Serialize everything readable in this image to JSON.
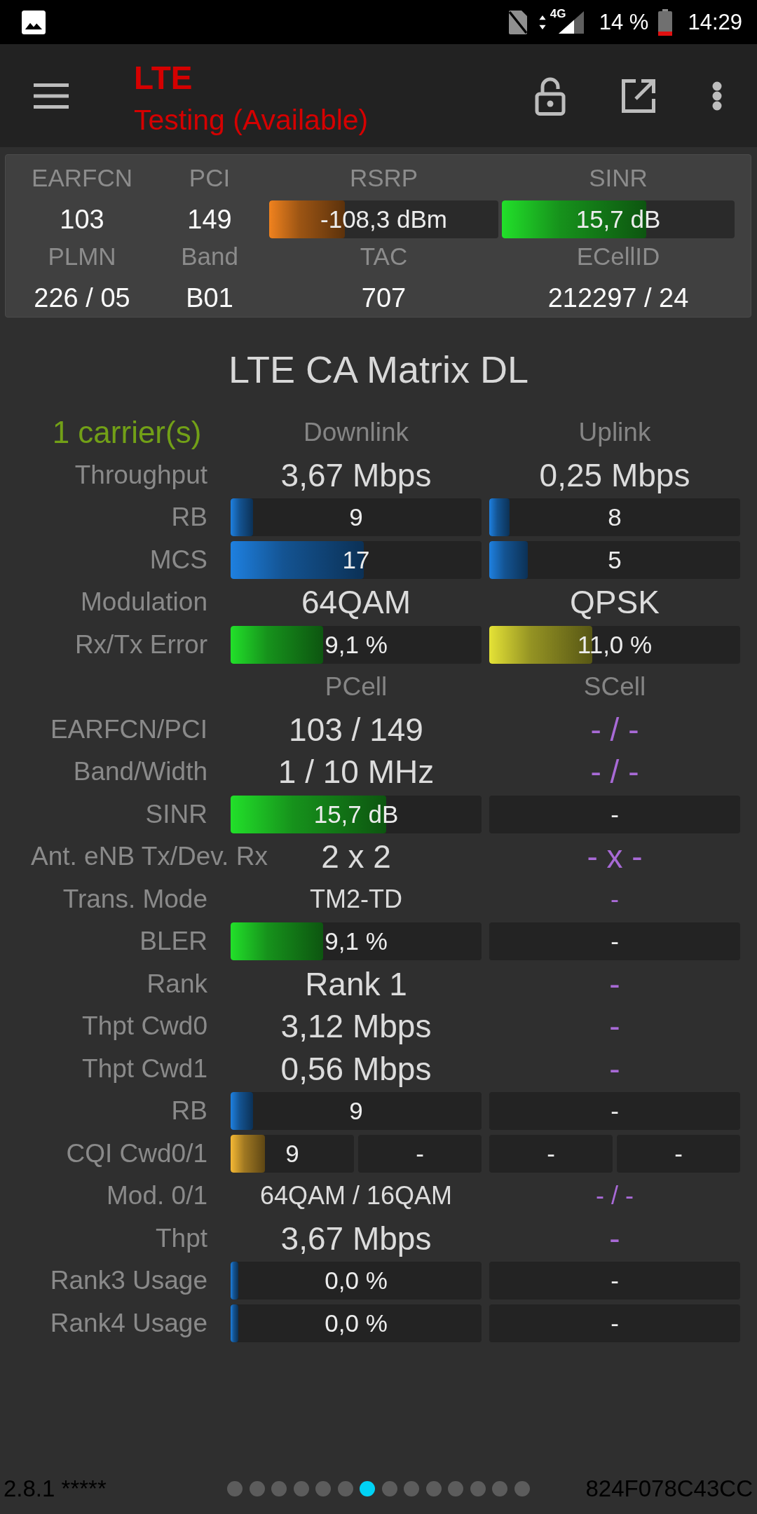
{
  "status_bar": {
    "network": "4G",
    "battery": "14 %",
    "time": "14:29"
  },
  "toolbar": {
    "title": "LTE",
    "subtitle": "Testing (Available)"
  },
  "info_panel": {
    "cells": [
      {
        "kind": "text",
        "label": "EARFCN",
        "value": "103"
      },
      {
        "kind": "text",
        "label": "PCI",
        "value": "149"
      },
      {
        "kind": "meter",
        "label": "RSRP",
        "value": "-108,3 dBm",
        "level": 0.33,
        "color": "#f0821e"
      },
      {
        "kind": "meter",
        "label": "SINR",
        "value": "15,7 dB",
        "level": 0.62,
        "color": "#22e02a"
      },
      {
        "kind": "text",
        "label": "PLMN",
        "value": "226 / 05"
      },
      {
        "kind": "text",
        "label": "Band",
        "value": "B01"
      },
      {
        "kind": "text",
        "label": "TAC",
        "value": "707"
      },
      {
        "kind": "text",
        "label": "ECellID",
        "value": "212297 / 24"
      }
    ]
  },
  "matrix": {
    "title": "LTE CA Matrix DL",
    "rows": [
      {
        "kind": "header",
        "label": "1 carrier(s)",
        "cells": [
          {
            "text": "Downlink"
          },
          {
            "text": "Uplink"
          }
        ]
      },
      {
        "kind": "value",
        "label": "Throughput",
        "cells": [
          {
            "text": "3,67 Mbps",
            "available": true
          },
          {
            "text": "0,25 Mbps",
            "available": true
          }
        ]
      },
      {
        "kind": "meter",
        "label": "RB",
        "cells": [
          {
            "text": "9",
            "level": 0.09,
            "color": "#1e80e0"
          },
          {
            "text": "8",
            "level": 0.08,
            "color": "#1e80e0"
          }
        ]
      },
      {
        "kind": "meter",
        "label": "MCS",
        "cells": [
          {
            "text": "17",
            "level": 0.53,
            "color": "#1e80e0"
          },
          {
            "text": "5",
            "level": 0.155,
            "color": "#1e80e0"
          }
        ]
      },
      {
        "kind": "value",
        "label": "Modulation",
        "cells": [
          {
            "text": "64QAM",
            "available": true
          },
          {
            "text": "QPSK",
            "available": true
          }
        ]
      },
      {
        "kind": "meter",
        "label": "Rx/Tx Error",
        "cells": [
          {
            "text": "9,1 %",
            "level": 0.37,
            "color": "#22e02a"
          },
          {
            "text": "11,0 %",
            "level": 0.41,
            "color": "#e4e236"
          }
        ]
      },
      {
        "kind": "header",
        "cells": [
          {
            "text": "PCell"
          },
          {
            "text": "SCell"
          }
        ]
      },
      {
        "kind": "value",
        "label": "EARFCN/PCI",
        "cells": [
          {
            "text": "103 / 149",
            "available": true
          },
          {
            "text": "- / -",
            "available": false
          }
        ]
      },
      {
        "kind": "value",
        "label": "Band/Width",
        "cells": [
          {
            "text": "1 / 10 MHz",
            "available": true
          },
          {
            "text": "- / -",
            "available": false
          }
        ]
      },
      {
        "kind": "meter",
        "label": "SINR",
        "cells": [
          {
            "text": "15,7 dB",
            "level": 0.62,
            "color": "#22e02a"
          },
          {
            "text": "-"
          }
        ]
      },
      {
        "kind": "value",
        "label": "Ant. eNB Tx/Dev. Rx",
        "cells": [
          {
            "text": "2 x 2",
            "available": true
          },
          {
            "text": "- x -",
            "available": false
          }
        ]
      },
      {
        "kind": "value_small",
        "label": "Trans. Mode",
        "cells": [
          {
            "text": "TM2-TD",
            "available": true
          },
          {
            "text": "-",
            "available": false
          }
        ]
      },
      {
        "kind": "meter",
        "label": "BLER",
        "cells": [
          {
            "text": "9,1 %",
            "level": 0.37,
            "color": "#22e02a"
          },
          {
            "text": "-"
          }
        ]
      },
      {
        "kind": "value",
        "label": "Rank",
        "cells": [
          {
            "text": "Rank 1",
            "available": true
          },
          {
            "text": "-",
            "available": false
          }
        ]
      },
      {
        "kind": "value",
        "label": "Thpt Cwd0",
        "cells": [
          {
            "text": "3,12 Mbps",
            "available": true
          },
          {
            "text": "-",
            "available": false
          }
        ]
      },
      {
        "kind": "value",
        "label": "Thpt Cwd1",
        "cells": [
          {
            "text": "0,56 Mbps",
            "available": true
          },
          {
            "text": "-",
            "available": false
          }
        ]
      },
      {
        "kind": "meter",
        "label": "RB",
        "cells": [
          {
            "text": "9",
            "level": 0.09,
            "color": "#1e80e0"
          },
          {
            "text": "-"
          }
        ]
      },
      {
        "kind": "split_meter",
        "label": "CQI Cwd0/1",
        "cells": [
          {
            "parts": [
              {
                "text": "9",
                "level": 0.28,
                "color": "#f5b834"
              },
              {
                "text": "-"
              }
            ]
          },
          {
            "parts": [
              {
                "text": "-"
              },
              {
                "text": "-"
              }
            ]
          }
        ]
      },
      {
        "kind": "value_small",
        "label": "Mod. 0/1",
        "cells": [
          {
            "text": "64QAM / 16QAM",
            "available": true
          },
          {
            "text": "- / -",
            "available": false
          }
        ]
      },
      {
        "kind": "value",
        "label": "Thpt",
        "cells": [
          {
            "text": "3,67 Mbps",
            "available": true
          },
          {
            "text": "-",
            "available": false
          }
        ]
      },
      {
        "kind": "meter",
        "label": "Rank3 Usage",
        "cells": [
          {
            "text": "0,0 %",
            "level": 0.03,
            "color": "#1e80e0"
          },
          {
            "text": "-"
          }
        ]
      },
      {
        "kind": "meter",
        "label": "Rank4 Usage",
        "cells": [
          {
            "text": "0,0 %",
            "level": 0.03,
            "color": "#1e80e0"
          },
          {
            "text": "-"
          }
        ]
      }
    ]
  },
  "footer": {
    "version": "2.8.1 *****",
    "pages": [
      {
        "selected": false
      },
      {
        "selected": false
      },
      {
        "selected": false
      },
      {
        "selected": false
      },
      {
        "selected": false
      },
      {
        "selected": false
      },
      {
        "selected": true
      },
      {
        "selected": false
      },
      {
        "selected": false
      },
      {
        "selected": false
      },
      {
        "selected": false
      },
      {
        "selected": false
      },
      {
        "selected": false
      },
      {
        "selected": false
      }
    ],
    "device_id": "824F078C43CC"
  }
}
